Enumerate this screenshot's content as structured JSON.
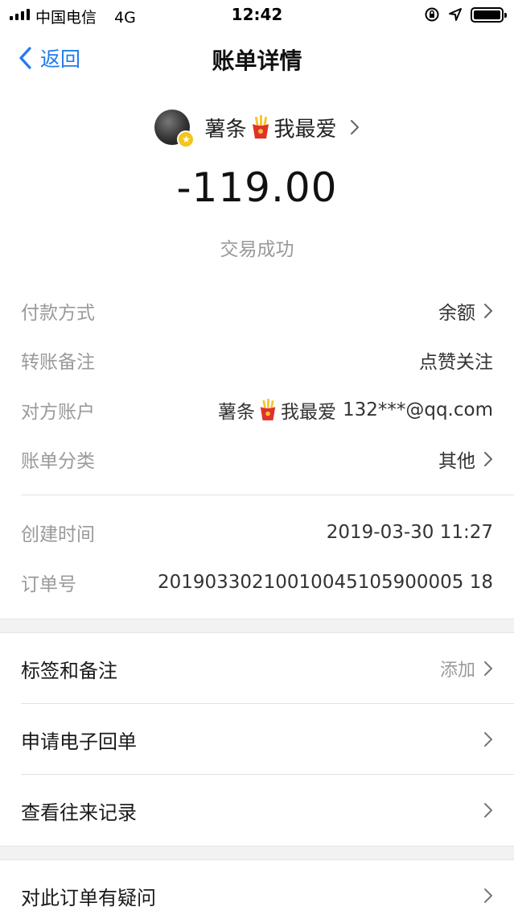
{
  "status_bar": {
    "carrier": "中国电信",
    "network": "4G",
    "time": "12:42"
  },
  "nav": {
    "back_label": "返回",
    "title": "账单详情"
  },
  "header": {
    "payee_name_part1": "薯条",
    "payee_name_part2": "我最爱",
    "amount": "-119.00",
    "status": "交易成功"
  },
  "details": {
    "payment_method_label": "付款方式",
    "payment_method_value": "余额",
    "remark_label": "转账备注",
    "remark_value": "点赞关注",
    "counterparty_label": "对方账户",
    "counterparty_name_part1": "薯条",
    "counterparty_name_part2": "我最爱",
    "counterparty_account": "132***@qq.com",
    "category_label": "账单分类",
    "category_value": "其他",
    "created_label": "创建时间",
    "created_value": "2019-03-30 11:27",
    "order_label": "订单号",
    "order_value": "20190330210010045105900005 18"
  },
  "actions": {
    "tags_label": "标签和备注",
    "tags_value": "添加",
    "receipt_label": "申请电子回单",
    "history_label": "查看往来记录",
    "question_label": "对此订单有疑问"
  },
  "colors": {
    "accent": "#1f7bf0",
    "muted": "#9a9a9a",
    "background_gap": "#f2f2f2"
  }
}
